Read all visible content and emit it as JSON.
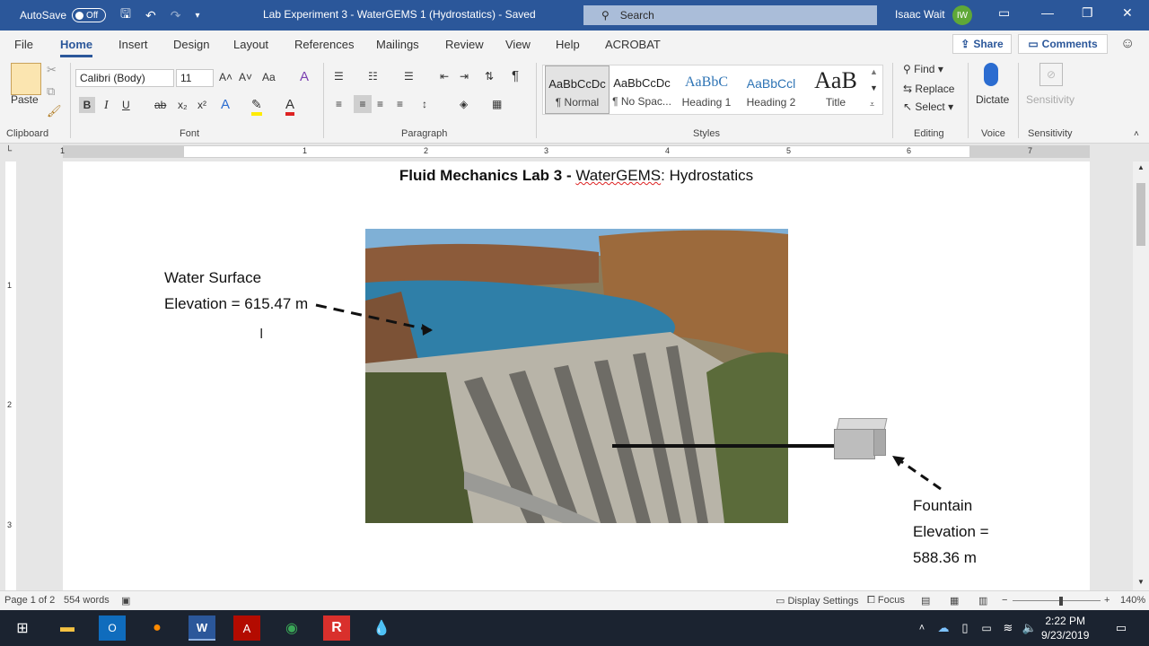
{
  "titlebar": {
    "autosave_label": "AutoSave",
    "autosave_state": "Off",
    "doc_title": "Lab Experiment 3 - WaterGEMS 1 (Hydrostatics)  -  Saved",
    "search_placeholder": "Search",
    "user_name": "Isaac Wait",
    "user_initials": "IW"
  },
  "tabs": [
    "File",
    "Home",
    "Insert",
    "Design",
    "Layout",
    "References",
    "Mailings",
    "Review",
    "View",
    "Help",
    "ACROBAT"
  ],
  "share_label": "Share",
  "comments_label": "Comments",
  "ribbon": {
    "clipboard": {
      "paste": "Paste",
      "label": "Clipboard"
    },
    "font": {
      "name": "Calibri (Body)",
      "size": "11",
      "label": "Font"
    },
    "paragraph": {
      "label": "Paragraph"
    },
    "styles": {
      "label": "Styles",
      "items": [
        {
          "sample": "AaBbCcDc",
          "name": "¶ Normal"
        },
        {
          "sample": "AaBbCcDc",
          "name": "¶ No Spac..."
        },
        {
          "sample": "AaBbC",
          "name": "Heading 1"
        },
        {
          "sample": "AaBbCcl",
          "name": "Heading 2"
        },
        {
          "sample": "AaB",
          "name": "Title"
        }
      ]
    },
    "editing": {
      "find": "Find",
      "replace": "Replace",
      "select": "Select",
      "label": "Editing"
    },
    "voice": {
      "dictate": "Dictate",
      "label": "Voice"
    },
    "sensitivity": {
      "button": "Sensitivity",
      "label": "Sensitivity"
    }
  },
  "ruler_numbers": [
    "1",
    "1",
    "2",
    "3",
    "4",
    "5",
    "6",
    "7"
  ],
  "vruler_numbers": [
    "1",
    "2",
    "3"
  ],
  "document": {
    "heading_bold": "Fluid Mechanics Lab 3 -",
    "heading_word": "WaterGEMS",
    "heading_rest": ": Hydrostatics",
    "water_line1": "Water Surface",
    "water_line2": "Elevation = 615.47 m",
    "fountain_line1": "Fountain",
    "fountain_line2": "Elevation =",
    "fountain_line3": "588.36 m"
  },
  "statusbar": {
    "page": "Page 1 of 2",
    "words": "554 words",
    "display_settings": "Display Settings",
    "focus": "Focus",
    "zoom": "140%"
  },
  "clock": {
    "time": "2:22 PM",
    "date": "9/23/2019"
  },
  "colors": {
    "word_blue": "#2b579a",
    "accent_red": "#d22"
  }
}
